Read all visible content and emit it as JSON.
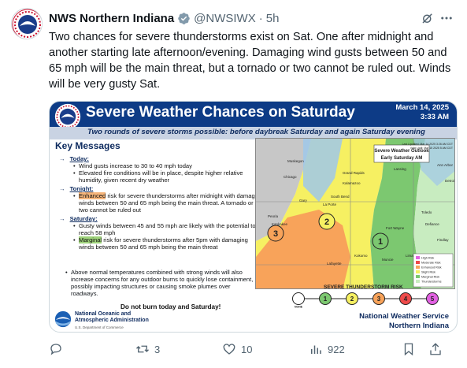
{
  "tweet": {
    "author_name": "NWS Northern Indiana",
    "handle": "@NWSIWX",
    "dot": "·",
    "time": "5h",
    "text": "Two chances for severe thunderstorms exist on Sat. One after midnight and another starting late afternoon/evening. Damaging wind gusts between 50 and 65 mph will be the main threat, but a tornado or two cannot be ruled out. Winds will be very gusty Sat."
  },
  "graphic": {
    "title": "Severe Weather Chances on Saturday",
    "date": "March 14, 2025",
    "time": "3:33 AM",
    "subtitle": "Two rounds of severe storms possible: before daybreak Saturday and again Saturday evening",
    "key_messages_title": "Key Messages",
    "sections": [
      {
        "label": "Today:",
        "bullets": [
          "Wind gusts increase to 30 to 40 mph today",
          "Elevated fire conditions will be in place, despite higher relative humidity, given recent dry weather"
        ]
      },
      {
        "label": "Tonight:",
        "highlight": "Enhanced",
        "bullets": [
          " risk for severe thunderstorms after midnight with damaging winds between 50 and 65 mph being the main threat. A tornado or two cannot be ruled out"
        ]
      },
      {
        "label": "Saturday:",
        "bullets": [
          "Gusty winds between 45 and 55 mph are likely with the potential to reach 58 mph"
        ],
        "highlight": "Marginal",
        "extra": " risk for severe thunderstorms after 5pm with damaging winds between 50 and 65 mph being the main threat"
      }
    ],
    "bottom_text": "Above normal temperatures combined with strong winds will also increase concerns for any outdoor burns to quickly lose containment, possibly impacting structures or causing smoke plumes over roadways.",
    "bottom_bold": "Do not burn today and Saturday!",
    "noaa_line1": "National Oceanic and",
    "noaa_line2": "Atmospheric Administration",
    "noaa_dept": "U.S. Department of Commerce",
    "nws_line1": "National Weather Service",
    "nws_line2": "Northern Indiana",
    "map": {
      "outlook_title": "Severe Weather Outlook",
      "outlook_sub": "Early Saturday AM",
      "last_updated": "Last Updated: Mar 14 2025 3:26 AM CDT",
      "valid_until": "Valid Until: Mar 15 2025 5 AM CDT",
      "legend_title": "SEVERE THUNDERSTORM RISK",
      "legend_items": [
        "High Risk",
        "Moderate Risk",
        "Enhanced Risk",
        "Slight Risk",
        "Marginal Risk",
        "Thunderstorms"
      ],
      "risk_levels": [
        {
          "num": "",
          "name": "NONE",
          "color": "#ffffff"
        },
        {
          "num": "1",
          "name": "",
          "color": "#7cc870"
        },
        {
          "num": "2",
          "name": "",
          "color": "#f6f062"
        },
        {
          "num": "3",
          "name": "",
          "color": "#f8a35a"
        },
        {
          "num": "4",
          "name": "",
          "color": "#ee4a4a"
        },
        {
          "num": "5",
          "name": "",
          "color": "#e261e2"
        }
      ],
      "cities": [
        "Muskegon",
        "Grand Rapids",
        "Lansing",
        "Kalamazoo",
        "Ann Arbor",
        "Detroit",
        "Toledo",
        "Chicago",
        "South Bend",
        "Fort Wayne",
        "Defiance",
        "Findlay",
        "Gary",
        "La Porte",
        "Peoria",
        "Kankakee",
        "Lafayette",
        "Kokomo",
        "Muncie",
        "Lima"
      ]
    }
  },
  "actions": {
    "replies": "",
    "retweets": "3",
    "likes": "10",
    "views": "922"
  },
  "colors": {
    "banner": "#0d3b86",
    "marginal": "#7cc870",
    "slight": "#f6f062",
    "enhanced": "#f8a35a",
    "icon_gray": "#536471",
    "verified_gray": "#829aab"
  }
}
